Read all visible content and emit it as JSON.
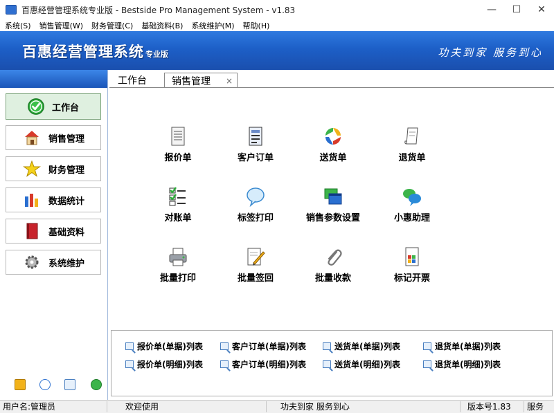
{
  "window": {
    "title": "百惠经营管理系统专业版 - Bestside Pro Management System - v1.83",
    "minimize": "—",
    "maximize": "☐",
    "close": "✕"
  },
  "menu": [
    "系统(S)",
    "销售管理(W)",
    "财务管理(C)",
    "基础资料(B)",
    "系统维护(M)",
    "帮助(H)"
  ],
  "banner": {
    "logo": "百惠经营管理系统",
    "edition": "专业版",
    "slogan": "功夫到家 服务到心"
  },
  "sidebar": {
    "items": [
      {
        "label": "工作台",
        "icon": "check-icon",
        "active": true
      },
      {
        "label": "销售管理",
        "icon": "house-icon",
        "active": false
      },
      {
        "label": "财务管理",
        "icon": "star-icon",
        "active": false
      },
      {
        "label": "数据统计",
        "icon": "bar-chart-icon",
        "active": false
      },
      {
        "label": "基础资料",
        "icon": "book-icon",
        "active": false
      },
      {
        "label": "系统维护",
        "icon": "gear-icon",
        "active": false
      }
    ],
    "tools": [
      "edit-icon",
      "clock-icon",
      "search-icon",
      "refresh-icon"
    ]
  },
  "tabs": {
    "home": "工作台",
    "current": "销售管理",
    "close": "×"
  },
  "functions": [
    {
      "label": "报价单",
      "icon": "document-icon"
    },
    {
      "label": "客户订单",
      "icon": "form-icon"
    },
    {
      "label": "送货单",
      "icon": "delivery-cycle-icon"
    },
    {
      "label": "退货单",
      "icon": "scroll-icon"
    },
    {
      "label": "对账单",
      "icon": "checklist-icon"
    },
    {
      "label": "标签打印",
      "icon": "speech-bubble-icon"
    },
    {
      "label": "销售参数设置",
      "icon": "windows-icon"
    },
    {
      "label": "小惠助理",
      "icon": "chat-icon"
    },
    {
      "label": "批量打印",
      "icon": "printer-icon"
    },
    {
      "label": "批量签回",
      "icon": "pencil-sign-icon"
    },
    {
      "label": "批量收款",
      "icon": "paperclip-icon"
    },
    {
      "label": "标记开票",
      "icon": "invoice-icon"
    }
  ],
  "lists": [
    "报价单(单据)列表",
    "客户订单(单据)列表",
    "送货单(单据)列表",
    "退货单(单据)列表",
    "报价单(明细)列表",
    "客户订单(明细)列表",
    "送货单(明细)列表",
    "退货单(明细)列表"
  ],
  "status": {
    "user": "用户名:管理员",
    "welcome": "欢迎使用",
    "slogan": "功夫到家 服务到心",
    "version": "版本号1.83",
    "service": "服务"
  },
  "colors": {
    "banner": "#1d5fc7",
    "active_nav": "#dff0e0"
  }
}
